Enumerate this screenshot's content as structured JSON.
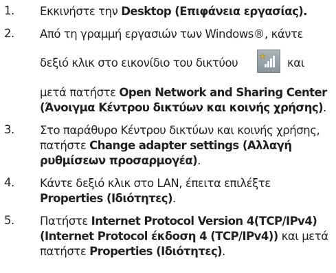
{
  "steps": [
    {
      "num": "1.",
      "lines": [
        {
          "a": "Εκκινήστε την ",
          "b": "Desktop (Επιφάνεια εργασίας).",
          "c": ""
        }
      ]
    },
    {
      "num": "2.",
      "lines": [
        {
          "a": "Από τη γραμμή εργασιών των Windows®, κάντε",
          "b": "",
          "c": ""
        },
        {
          "a": "δεξιό κλικ στο εικονίδιο του δικτύου",
          "b": "",
          "c": "και"
        },
        {
          "a": "μετά πατήστε ",
          "b": "Open Network and Sharing Center",
          "c": ""
        },
        {
          "a": "",
          "b": "(Άνοιγμα Κέντρου δικτύων και κοινής χρήσης)",
          "c": "."
        }
      ]
    },
    {
      "num": "3.",
      "lines": [
        {
          "a": "Στο παράθυρο Κέντρου δικτύων και κοινής χρήσης,",
          "b": "",
          "c": ""
        },
        {
          "a": "πατήστε ",
          "b": "Change adapter settings (Αλλαγή",
          "c": ""
        },
        {
          "a": "",
          "b": "ρυθμίσεων προσαρμογέα)",
          "c": "."
        }
      ]
    },
    {
      "num": "4.",
      "lines": [
        {
          "a": "Κάντε δεξιό κλικ στο LAN, έπειτα επιλέξτε",
          "b": "",
          "c": ""
        },
        {
          "a": "",
          "b": "Properties (Ιδιότητες)",
          "c": "."
        }
      ]
    },
    {
      "num": "5.",
      "lines": [
        {
          "a": "Πατήστε ",
          "b": "Internet Protocol Version 4(TCP/IPv4)",
          "c": ""
        },
        {
          "a": "",
          "b": "(Internet Protocol έκδοση 4 (TCP/IPv4))",
          "c": " και μετά"
        },
        {
          "a": "πατήστε ",
          "b": "Properties (Ιδιότητες)",
          "c": "."
        }
      ]
    }
  ],
  "icons": {
    "network": "network-tray-icon"
  }
}
